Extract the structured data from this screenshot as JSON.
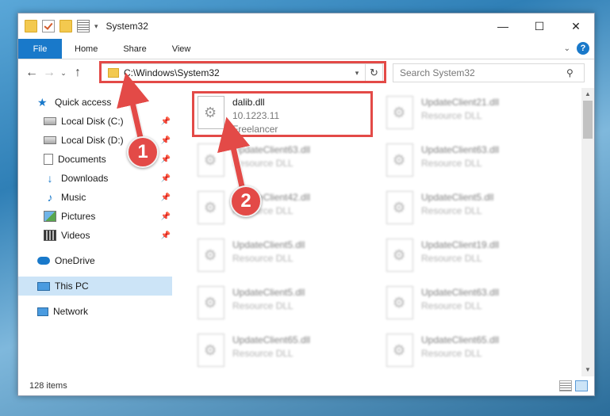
{
  "window": {
    "title": "System32",
    "quick_access_toolbar": [
      "folder-icon",
      "properties-check-icon",
      "new-folder-icon",
      "properties-icon",
      "customize-dropdown"
    ],
    "controls": {
      "minimize": "—",
      "maximize": "☐",
      "close": "✕"
    }
  },
  "ribbon": {
    "tabs": [
      {
        "label": "File",
        "active": true
      },
      {
        "label": "Home"
      },
      {
        "label": "Share"
      },
      {
        "label": "View"
      }
    ],
    "help": "?"
  },
  "navigation": {
    "back": "←",
    "forward": "→",
    "recent": "⌄",
    "up": "↑",
    "address": "C:\\Windows\\System32",
    "refresh": "↻",
    "search_placeholder": "Search System32"
  },
  "sidebar": {
    "items": [
      {
        "label": "Quick access",
        "icon": "star-icon"
      },
      {
        "label": "Local Disk (C:)",
        "icon": "disk-icon",
        "pinned": true
      },
      {
        "label": "Local Disk (D:)",
        "icon": "disk-icon",
        "pinned": true
      },
      {
        "label": "Documents",
        "icon": "documents-icon",
        "pinned": true
      },
      {
        "label": "Downloads",
        "icon": "downloads-icon",
        "pinned": true
      },
      {
        "label": "Music",
        "icon": "music-icon",
        "pinned": true
      },
      {
        "label": "Pictures",
        "icon": "pictures-icon",
        "pinned": true
      },
      {
        "label": "Videos",
        "icon": "videos-icon",
        "pinned": true
      },
      {
        "label": "OneDrive",
        "icon": "onedrive-icon"
      },
      {
        "label": "This PC",
        "icon": "this-pc-icon",
        "selected": true
      },
      {
        "label": "Network",
        "icon": "network-icon"
      }
    ]
  },
  "files": [
    {
      "name": "dalib.dll",
      "version": "10.1223.11",
      "company": "Freelancer"
    },
    {
      "name": "UpdateClient21.dll",
      "type": "Resource DLL"
    },
    {
      "name": "UpdateClient63.dll",
      "type": "Resource DLL"
    },
    {
      "name": "UpdateClient63.dll",
      "type": "Resource DLL"
    },
    {
      "name": "UpdateClient42.dll",
      "type": "Resource DLL"
    },
    {
      "name": "UpdateClient5.dll",
      "type": "Resource DLL"
    },
    {
      "name": "UpdateClient5.dll",
      "type": "Resource DLL"
    },
    {
      "name": "UpdateClient19.dll",
      "type": "Resource DLL"
    },
    {
      "name": "UpdateClient5.dll",
      "type": "Resource DLL"
    },
    {
      "name": "UpdateClient63.dll",
      "type": "Resource DLL"
    },
    {
      "name": "UpdateClient65.dll",
      "type": "Resource DLL"
    },
    {
      "name": "UpdateClient65.dll",
      "type": "Resource DLL"
    }
  ],
  "status": {
    "item_count": "128 items"
  },
  "annotations": {
    "step1": "1",
    "step2": "2",
    "color": "#e34a47"
  }
}
